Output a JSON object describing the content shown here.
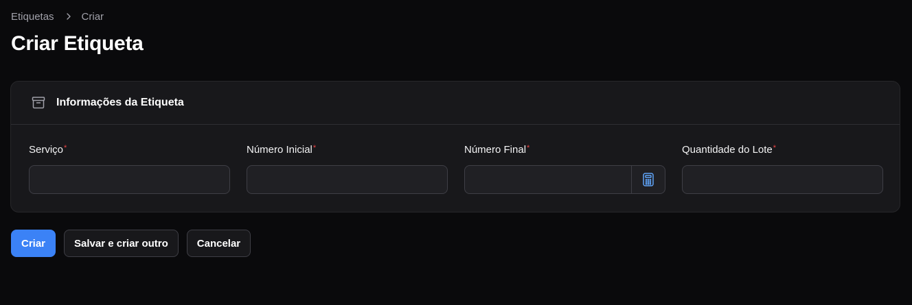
{
  "breadcrumb": {
    "items": [
      "Etiquetas",
      "Criar"
    ],
    "separator_icon": "chevron-right-icon"
  },
  "page": {
    "title": "Criar Etiqueta"
  },
  "section": {
    "title": "Informações da Etiqueta",
    "icon": "archive-box-icon"
  },
  "fields": [
    {
      "label": "Serviço",
      "required_mark": "*",
      "value": "",
      "placeholder": ""
    },
    {
      "label": "Número Inicial",
      "required_mark": "*",
      "value": "",
      "placeholder": ""
    },
    {
      "label": "Número Final",
      "required_mark": "*",
      "value": "",
      "placeholder": "",
      "suffix_icon": "calculator-icon"
    },
    {
      "label": "Quantidade do Lote",
      "required_mark": "*",
      "value": "",
      "placeholder": ""
    }
  ],
  "actions": {
    "create": "Criar",
    "save_and_create_another": "Salvar e criar outro",
    "cancel": "Cancelar"
  },
  "colors": {
    "background": "#0a0a0c",
    "card": "#18181b",
    "primary": "#3b82f6",
    "required": "#ef4444",
    "icon_accent": "#60a5fa"
  }
}
